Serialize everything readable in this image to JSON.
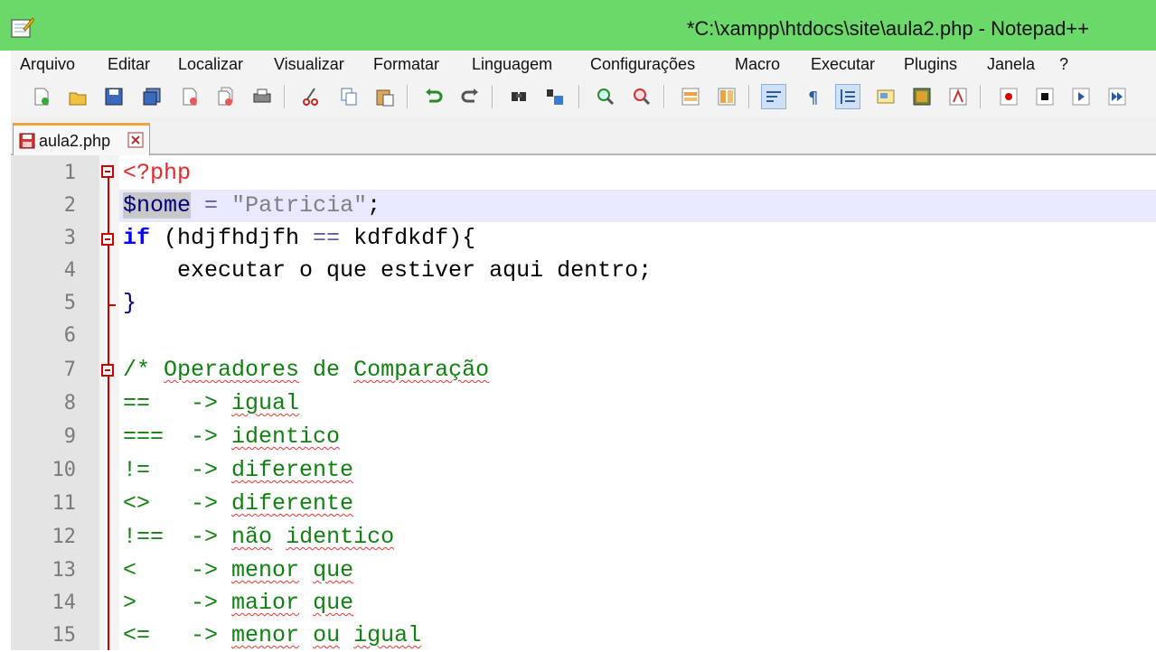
{
  "window": {
    "title": "*C:\\xampp\\htdocs\\site\\aula2.php - Notepad++"
  },
  "menu": [
    "Arquivo",
    "Editar",
    "Localizar",
    "Visualizar",
    "Formatar",
    "Linguagem",
    "Configurações",
    "Macro",
    "Executar",
    "Plugins",
    "Janela",
    "?"
  ],
  "toolbar": {
    "buttons": [
      "new-file-icon",
      "open-file-icon",
      "save-icon",
      "save-all-icon",
      "close-icon",
      "close-all-icon",
      "print-icon",
      "cut-icon",
      "copy-icon",
      "paste-icon",
      "undo-icon",
      "redo-icon",
      "find-icon",
      "replace-icon",
      "zoom-in-icon",
      "zoom-out-icon",
      "sync-vertical-icon",
      "sync-horizontal-icon",
      "word-wrap-icon",
      "show-all-chars-icon",
      "indent-guide-icon",
      "doc-map-icon",
      "function-list-icon",
      "folder-workspace-icon",
      "record-macro-icon",
      "stop-record-icon",
      "playback-icon",
      "run-multiple-icon"
    ]
  },
  "tabs": [
    {
      "label": "aula2.php",
      "modified": true
    }
  ],
  "editor": {
    "line_numbers": [
      "1",
      "2",
      "3",
      "4",
      "5",
      "6",
      "7",
      "8",
      "9",
      "10",
      "11",
      "12",
      "13",
      "14",
      "15"
    ],
    "lines": {
      "l1": {
        "tag": "<?php"
      },
      "l2": {
        "var": "$nome",
        "op": "=",
        "str": "\"Patricia\"",
        "end": ";"
      },
      "l3": {
        "kw": "if",
        "pre": " (hdjfhdjfh ",
        "op": "==",
        "post": " kdfdkdf){"
      },
      "l4": {
        "text": "    executar o que estiver aqui dentro;"
      },
      "l5": {
        "text": "}"
      },
      "l6": {
        "text": ""
      },
      "l7": {
        "start": "/* ",
        "w1": "Operadores",
        "mid": " de ",
        "w2": "Comparação"
      },
      "l8": {
        "op": "==",
        "arrow": "   -> ",
        "desc": "igual"
      },
      "l9": {
        "op": "===",
        "arrow": "  -> ",
        "desc": "identico"
      },
      "l10": {
        "op": "!=",
        "arrow": "   -> ",
        "desc": "diferente"
      },
      "l11": {
        "op": "<>",
        "arrow": "   -> ",
        "desc": "diferente"
      },
      "l12": {
        "op": "!==",
        "arrow": "  -> ",
        "desc1": "não",
        "desc2": "identico"
      },
      "l13": {
        "op": "<",
        "arrow": "    -> ",
        "desc1": "menor",
        "desc2": "que"
      },
      "l14": {
        "op": ">",
        "arrow": "    -> ",
        "desc1": "maior",
        "desc2": "que"
      },
      "l15": {
        "op": "<=",
        "arrow": "   -> ",
        "desc1": "menor",
        "desc2": "ou",
        "desc3": "igual"
      }
    }
  },
  "colors": {
    "titlebar": "#6ad96a",
    "php_tag": "#e8292b",
    "keyword": "#0000ff",
    "comment": "#108010",
    "fold_marker": "#cc0000",
    "current_line": "#e8e8ff"
  }
}
